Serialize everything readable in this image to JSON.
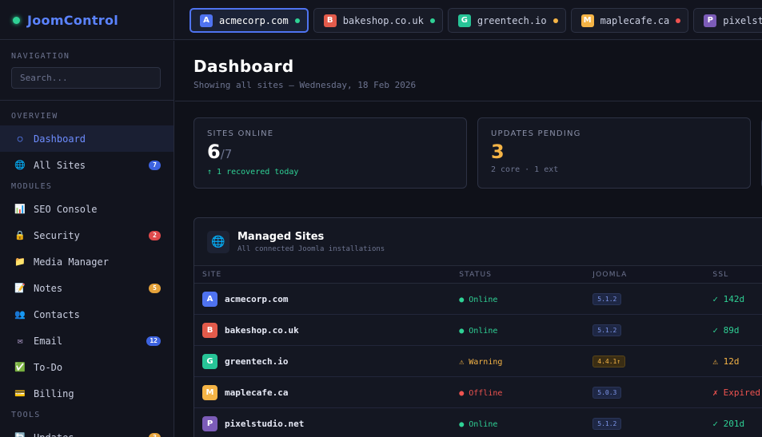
{
  "app": {
    "name": "JoomControl"
  },
  "tabs": [
    {
      "letter": "A",
      "label": "acmecorp.com",
      "color": "#4f73f0",
      "dot": "#2fd195",
      "active": true
    },
    {
      "letter": "B",
      "label": "bakeshop.co.uk",
      "color": "#e35b4b",
      "dot": "#2fd195"
    },
    {
      "letter": "G",
      "label": "greentech.io",
      "color": "#27c497",
      "dot": "#f5b446"
    },
    {
      "letter": "M",
      "label": "maplecafe.ca",
      "color": "#f5b446",
      "dot": "#ef5350"
    },
    {
      "letter": "P",
      "label": "pixelstudio",
      "color": "#7c5cb8",
      "dot": ""
    }
  ],
  "sidebar": {
    "navigation_label": "NAVIGATION",
    "search_placeholder": "Search...",
    "overview_label": "OVERVIEW",
    "modules_label": "MODULES",
    "tools_label": "TOOLS",
    "overview": [
      {
        "name": "dashboard",
        "icon": "○",
        "icon_name": "dashboard-icon",
        "icon_color": "#5b83ff",
        "label": "Dashboard",
        "active": true
      },
      {
        "name": "all-sites",
        "icon": "🌐",
        "icon_name": "globe-icon",
        "label": "All Sites",
        "badge": "7",
        "badge_color": "#3d63e0"
      }
    ],
    "modules": [
      {
        "name": "seo-console",
        "icon": "📊",
        "icon_name": "chart-icon",
        "label": "SEO Console"
      },
      {
        "name": "security",
        "icon": "🔒",
        "icon_name": "lock-icon",
        "label": "Security",
        "badge": "2",
        "badge_color": "#e0494b"
      },
      {
        "name": "media-manager",
        "icon": "📁",
        "icon_name": "folder-icon",
        "label": "Media Manager"
      },
      {
        "name": "notes",
        "icon": "📝",
        "icon_name": "notes-icon",
        "label": "Notes",
        "badge": "5",
        "badge_color": "#e5a23a"
      },
      {
        "name": "contacts",
        "icon": "👥",
        "icon_name": "contacts-icon",
        "label": "Contacts"
      },
      {
        "name": "email",
        "icon": "✉",
        "icon_name": "envelope-icon",
        "icon_color": "#b9a4d6",
        "label": "Email",
        "badge": "12",
        "badge_color": "#3d63e0"
      },
      {
        "name": "to-do",
        "icon": "✅",
        "icon_name": "checkbox-icon",
        "label": "To-Do"
      },
      {
        "name": "billing",
        "icon": "💳",
        "icon_name": "credit-card-icon",
        "label": "Billing"
      }
    ],
    "tools": [
      {
        "name": "updates",
        "icon": "🔄",
        "icon_name": "refresh-icon",
        "label": "Updates",
        "badge": "3",
        "badge_color": "#e5a23a"
      }
    ]
  },
  "main": {
    "title": "Dashboard",
    "subtitle": "Showing all sites — Wednesday, 18 Feb 2026"
  },
  "stats": [
    {
      "label": "SITES ONLINE",
      "value": "6",
      "total": "/7",
      "note": "↑ 1 recovered today",
      "note_color": "#2fd195",
      "value_color": "#ffffff"
    },
    {
      "label": "UPDATES PENDING",
      "value": "3",
      "total": "",
      "note": "2 core · 1 ext",
      "note_color": "#6d7490",
      "value_color": "#f5b446"
    }
  ],
  "sites_panel": {
    "title": "Managed Sites",
    "subtitle": "All connected Joomla installations",
    "columns": {
      "site": "SITE",
      "status": "STATUS",
      "joomla": "JOOMLA",
      "ssl": "SSL"
    },
    "rows": [
      {
        "letter": "A",
        "color": "#4f73f0",
        "site": "acmecorp.com",
        "status": "● Online",
        "status_color": "#2fd195",
        "joomla": "5.1.2",
        "joomla_warn": false,
        "ssl": "✓ 142d",
        "ssl_color": "#2fd195"
      },
      {
        "letter": "B",
        "color": "#e35b4b",
        "site": "bakeshop.co.uk",
        "status": "● Online",
        "status_color": "#2fd195",
        "joomla": "5.1.2",
        "joomla_warn": false,
        "ssl": "✓ 89d",
        "ssl_color": "#2fd195"
      },
      {
        "letter": "G",
        "color": "#27c497",
        "site": "greentech.io",
        "status": "⚠ Warning",
        "status_color": "#f5b446",
        "joomla": "4.4.1↑",
        "joomla_warn": true,
        "ssl": "⚠ 12d",
        "ssl_color": "#f5b446"
      },
      {
        "letter": "M",
        "color": "#f5b446",
        "site": "maplecafe.ca",
        "status": "● Offline",
        "status_color": "#ef5350",
        "joomla": "5.0.3",
        "joomla_warn": false,
        "ssl": "✗ Expired",
        "ssl_color": "#ef5350"
      },
      {
        "letter": "P",
        "color": "#7c5cb8",
        "site": "pixelstudio.net",
        "status": "● Online",
        "status_color": "#2fd195",
        "joomla": "5.1.2",
        "joomla_warn": false,
        "ssl": "✓ 201d",
        "ssl_color": "#2fd195"
      }
    ]
  }
}
